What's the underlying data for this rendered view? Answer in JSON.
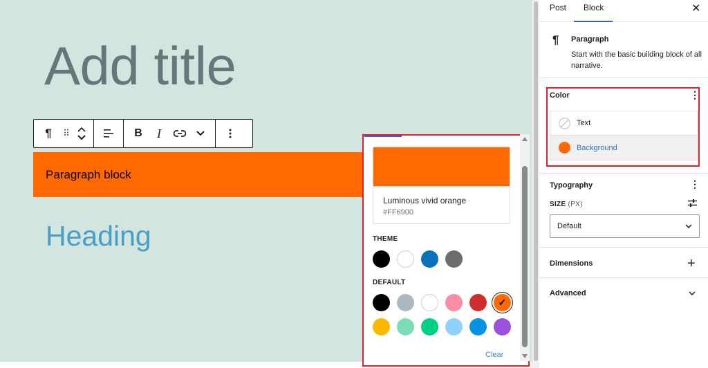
{
  "editor": {
    "title_placeholder": "Add title",
    "paragraph_text": "Paragraph block",
    "heading_text": "Heading"
  },
  "toolbar": {
    "block_icon": "¶",
    "drag_icon": "⠿",
    "bold": "B",
    "italic": "I"
  },
  "color_picker": {
    "selected_name": "Luminous vivid orange",
    "selected_hex": "#FF6900",
    "theme_label": "THEME",
    "theme_colors": [
      "#000000",
      "#ffffff",
      "#0a72b8",
      "#6d6d6d"
    ],
    "default_label": "DEFAULT",
    "default_colors": [
      "#000000",
      "#abb8c3",
      "#ffffff",
      "#f78da7",
      "#cf2e2e",
      "#ff6900",
      "#fcb900",
      "#7bdcb5",
      "#00d084",
      "#8ed1fc",
      "#0693e3",
      "#9b51e0"
    ],
    "clear_label": "Clear"
  },
  "sidebar": {
    "tabs": [
      "Post",
      "Block"
    ],
    "close": "✕",
    "block_name": "Paragraph",
    "block_description": "Start with the basic building block of all narrative.",
    "color_title": "Color",
    "color_text_label": "Text",
    "color_background_label": "Background",
    "typography_title": "Typography",
    "size_label": "SIZE",
    "size_unit": "(PX)",
    "size_value": "Default",
    "dimensions_title": "Dimensions",
    "advanced_title": "Advanced"
  }
}
